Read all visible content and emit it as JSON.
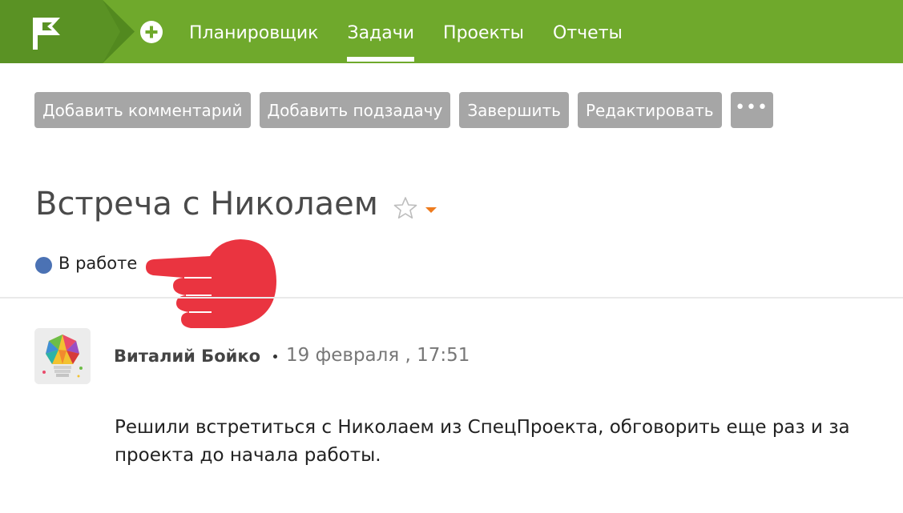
{
  "header": {
    "nav": [
      {
        "label": "Планировщик"
      },
      {
        "label": "Задачи",
        "active": true
      },
      {
        "label": "Проекты"
      },
      {
        "label": "Отчеты"
      }
    ],
    "accent_color": "#6fa92c"
  },
  "toolbar": {
    "add_comment": "Добавить комментарий",
    "add_subtask": "Добавить подзадачу",
    "complete": "Завершить",
    "edit": "Редактировать",
    "more": "•••"
  },
  "task": {
    "title": "Встреча с Николаем",
    "status": "В работе",
    "status_color": "#4b72b4"
  },
  "comment": {
    "author": "Виталий Бойко",
    "date": "19 февраля , 17:51",
    "text_line1": "Решили встретиться с Николаем из СпецПроекта, обговорить еще раз и за",
    "text_line2": "проекта до начала работы."
  },
  "icons": {
    "logo": "flag-logo-icon",
    "add": "plus-circle-icon",
    "favorite": "star-outline-icon",
    "dropdown": "caret-down-icon",
    "annotation": "pointing-hand-icon"
  }
}
